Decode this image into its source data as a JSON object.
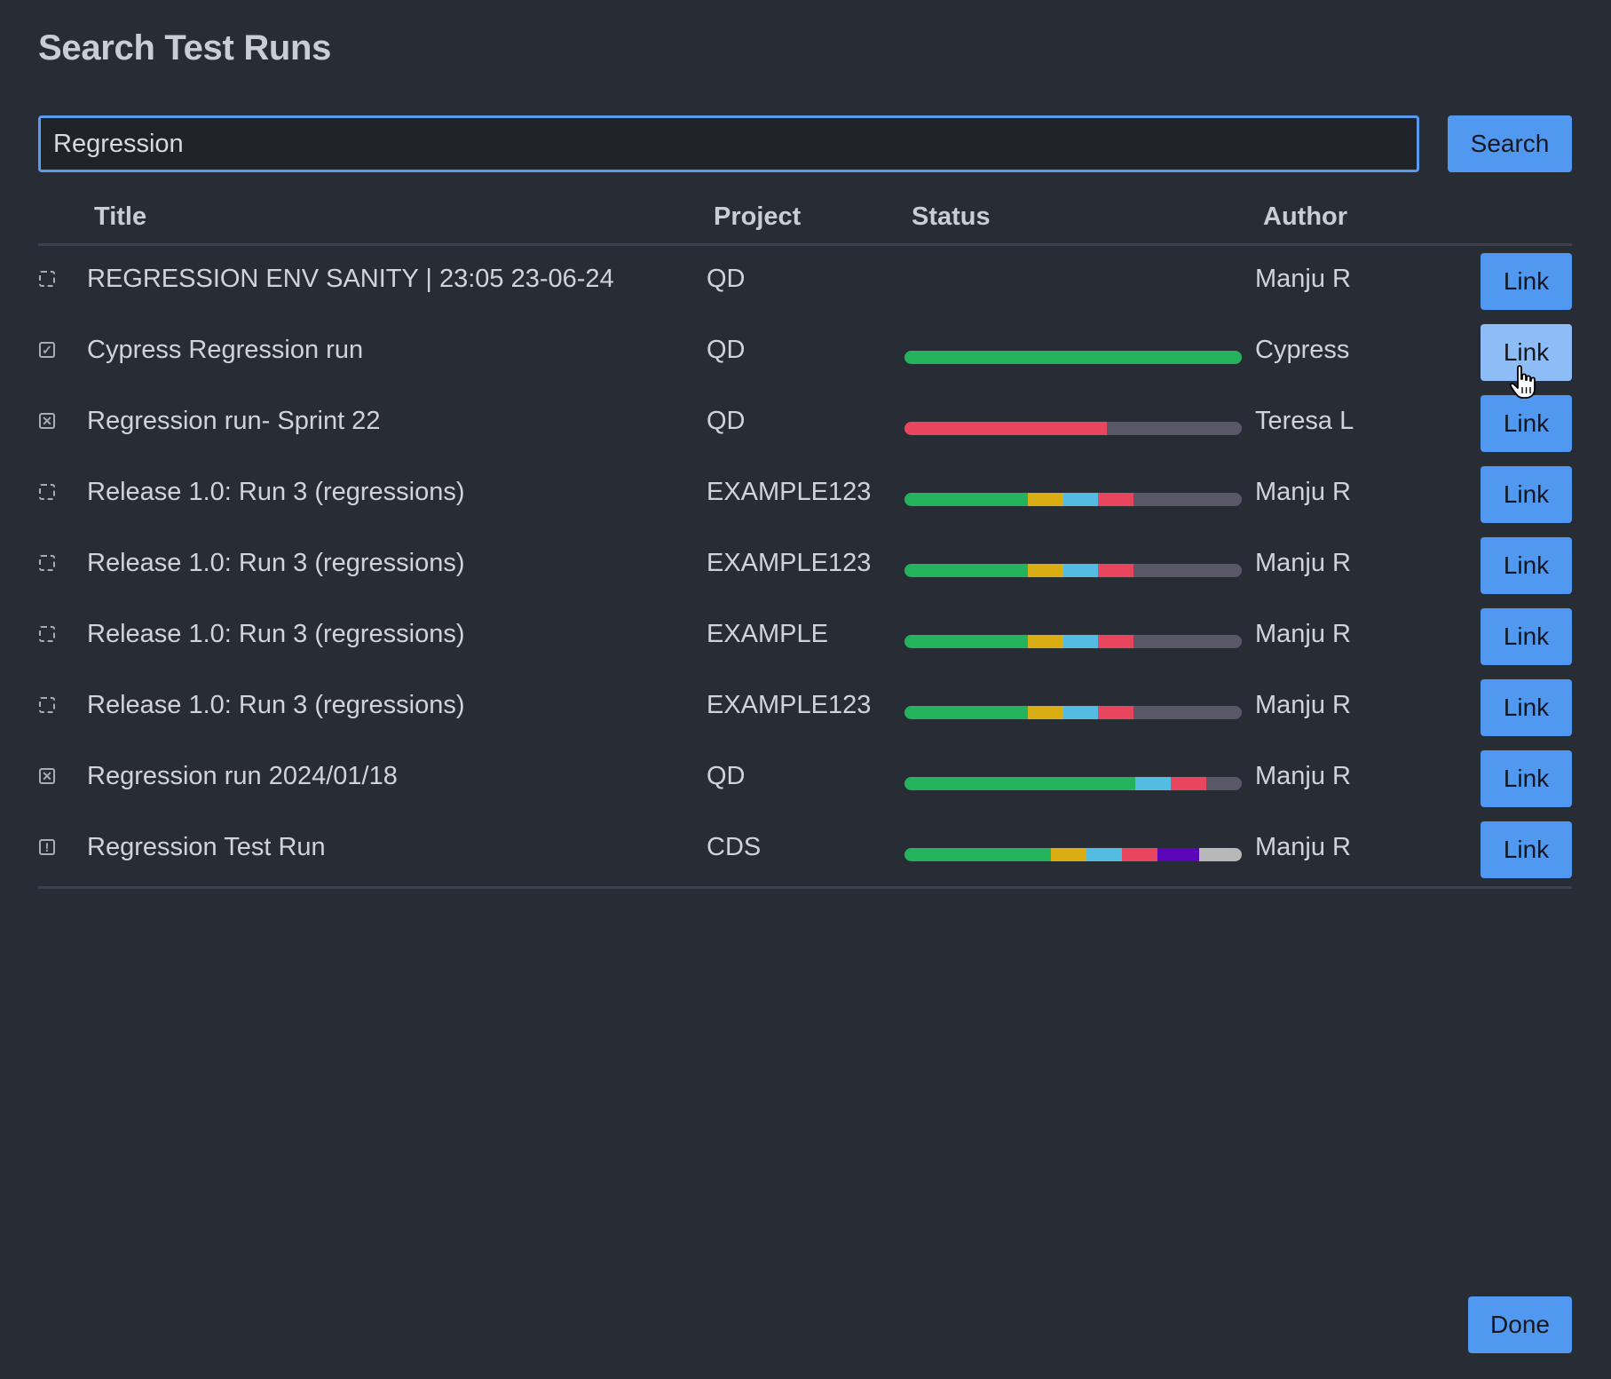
{
  "title": "Search Test Runs",
  "search": {
    "value": "Regression",
    "button_label": "Search"
  },
  "columns": {
    "title": "Title",
    "project": "Project",
    "status": "Status",
    "author": "Author"
  },
  "status_colors": {
    "passed": "#24b35a",
    "blocked": "#d9ae12",
    "retest": "#52bde0",
    "failed": "#e8465f",
    "untested": "#5a5868",
    "custom": "#5a06b8",
    "other": "#b8b8b8"
  },
  "rows": [
    {
      "state": "none",
      "title": "REGRESSION ENV SANITY | 23:05 23-06-24",
      "project": "QD",
      "author": "Manju R",
      "link_label": "Link",
      "status": []
    },
    {
      "state": "check",
      "title": "Cypress Regression run",
      "project": "QD",
      "author": "Cypress",
      "link_label": "Link",
      "hovered": true,
      "status": [
        {
          "kind": "passed",
          "pct": 100
        }
      ]
    },
    {
      "state": "cross",
      "title": "Regression run- Sprint 22",
      "project": "QD",
      "author": "Teresa L",
      "link_label": "Link",
      "status": [
        {
          "kind": "failed",
          "pct": 60
        },
        {
          "kind": "untested",
          "pct": 40
        }
      ]
    },
    {
      "state": "none",
      "title": "Release 1.0: Run 3 (regressions)",
      "project": "EXAMPLE123",
      "author": "Manju R",
      "link_label": "Link",
      "status": [
        {
          "kind": "passed",
          "pct": 36.5
        },
        {
          "kind": "blocked",
          "pct": 10.5
        },
        {
          "kind": "retest",
          "pct": 10.5
        },
        {
          "kind": "failed",
          "pct": 10.5
        },
        {
          "kind": "untested",
          "pct": 32
        }
      ]
    },
    {
      "state": "none",
      "title": "Release 1.0: Run 3 (regressions)",
      "project": "EXAMPLE123",
      "author": "Manju R",
      "link_label": "Link",
      "status": [
        {
          "kind": "passed",
          "pct": 36.5
        },
        {
          "kind": "blocked",
          "pct": 10.5
        },
        {
          "kind": "retest",
          "pct": 10.5
        },
        {
          "kind": "failed",
          "pct": 10.5
        },
        {
          "kind": "untested",
          "pct": 32
        }
      ]
    },
    {
      "state": "none",
      "title": "Release 1.0: Run 3 (regressions)",
      "project": "EXAMPLE",
      "author": "Manju R",
      "link_label": "Link",
      "status": [
        {
          "kind": "passed",
          "pct": 36.5
        },
        {
          "kind": "blocked",
          "pct": 10.5
        },
        {
          "kind": "retest",
          "pct": 10.5
        },
        {
          "kind": "failed",
          "pct": 10.5
        },
        {
          "kind": "untested",
          "pct": 32
        }
      ]
    },
    {
      "state": "none",
      "title": "Release 1.0: Run 3 (regressions)",
      "project": "EXAMPLE123",
      "author": "Manju R",
      "link_label": "Link",
      "status": [
        {
          "kind": "passed",
          "pct": 36.5
        },
        {
          "kind": "blocked",
          "pct": 10.5
        },
        {
          "kind": "retest",
          "pct": 10.5
        },
        {
          "kind": "failed",
          "pct": 10.5
        },
        {
          "kind": "untested",
          "pct": 32
        }
      ]
    },
    {
      "state": "cross",
      "title": "Regression run 2024/01/18",
      "project": "QD",
      "author": "Manju R",
      "link_label": "Link",
      "status": [
        {
          "kind": "passed",
          "pct": 68.5
        },
        {
          "kind": "retest",
          "pct": 10.5
        },
        {
          "kind": "failed",
          "pct": 10.5
        },
        {
          "kind": "untested",
          "pct": 10.5
        }
      ]
    },
    {
      "state": "warn",
      "title": "Regression Test Run",
      "project": "CDS",
      "author": "Manju R",
      "link_label": "Link",
      "status": [
        {
          "kind": "passed",
          "pct": 43.5
        },
        {
          "kind": "blocked",
          "pct": 10.5
        },
        {
          "kind": "retest",
          "pct": 10.5
        },
        {
          "kind": "failed",
          "pct": 10.5
        },
        {
          "kind": "custom",
          "pct": 12.5
        },
        {
          "kind": "other",
          "pct": 12.5
        }
      ]
    }
  ],
  "footer": {
    "done_label": "Done"
  }
}
